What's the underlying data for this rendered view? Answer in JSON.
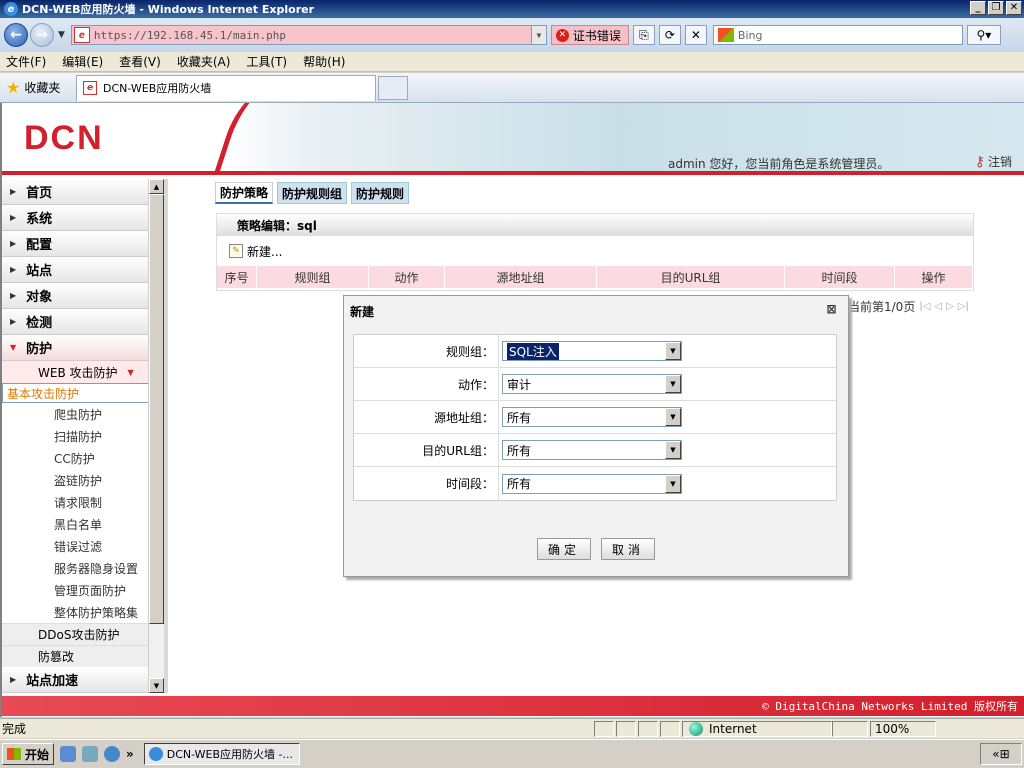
{
  "window": {
    "title": "DCN-WEB应用防火墙 - Windows Internet Explorer",
    "minimize": "_",
    "maximize": "❐",
    "close": "✕"
  },
  "addressbar": {
    "url": "https://192.168.45.1/main.php",
    "cert_error": "证书错误",
    "search_placeholder": "Bing"
  },
  "menu": [
    "文件(F)",
    "编辑(E)",
    "查看(V)",
    "收藏夹(A)",
    "工具(T)",
    "帮助(H)"
  ],
  "favorites": {
    "label": "收藏夹",
    "tab_title": "DCN-WEB应用防火墙"
  },
  "header": {
    "logo": "DCN",
    "user_info": "admin 您好，您当前角色是系统管理员。",
    "logout": "注销"
  },
  "sidebar": {
    "sections": [
      "首页",
      "系统",
      "配置",
      "站点",
      "对象",
      "检测"
    ],
    "active": "防护",
    "sub_active": "WEB 攻击防护",
    "leaves": [
      "基本攻击防护",
      "爬虫防护",
      "扫描防护",
      "CC防护",
      "盗链防护",
      "请求限制",
      "黑白名单",
      "错误过滤",
      "服务器隐身设置",
      "管理页面防护",
      "整体防护策略集"
    ],
    "selected_leaf": "基本攻击防护",
    "sub2": [
      "DDoS攻击防护",
      "防篡改"
    ],
    "last_section": "站点加速"
  },
  "tabs": [
    "防护策略",
    "防护规则组",
    "防护规则"
  ],
  "panel": {
    "title": "策略编辑：sql",
    "new_label": "新建...",
    "columns": [
      "序号",
      "规则组",
      "动作",
      "源地址组",
      "目的URL组",
      "时间段",
      "操作"
    ]
  },
  "pager": {
    "text": "当前第1/0页"
  },
  "modal": {
    "title": "新建",
    "fields": [
      {
        "label": "规则组：",
        "value": "SQL注入"
      },
      {
        "label": "动作：",
        "value": "审计"
      },
      {
        "label": "源地址组：",
        "value": "所有"
      },
      {
        "label": "目的URL组：",
        "value": "所有"
      },
      {
        "label": "时间段：",
        "value": "所有"
      }
    ],
    "ok": "确定",
    "cancel": "取消"
  },
  "footer": "© DigitalChina Networks Limited 版权所有",
  "status": {
    "text": "完成",
    "zone": "Internet",
    "zoom": "100%"
  },
  "taskbar": {
    "start": "开始",
    "item": "DCN-WEB应用防火墙 -..."
  }
}
